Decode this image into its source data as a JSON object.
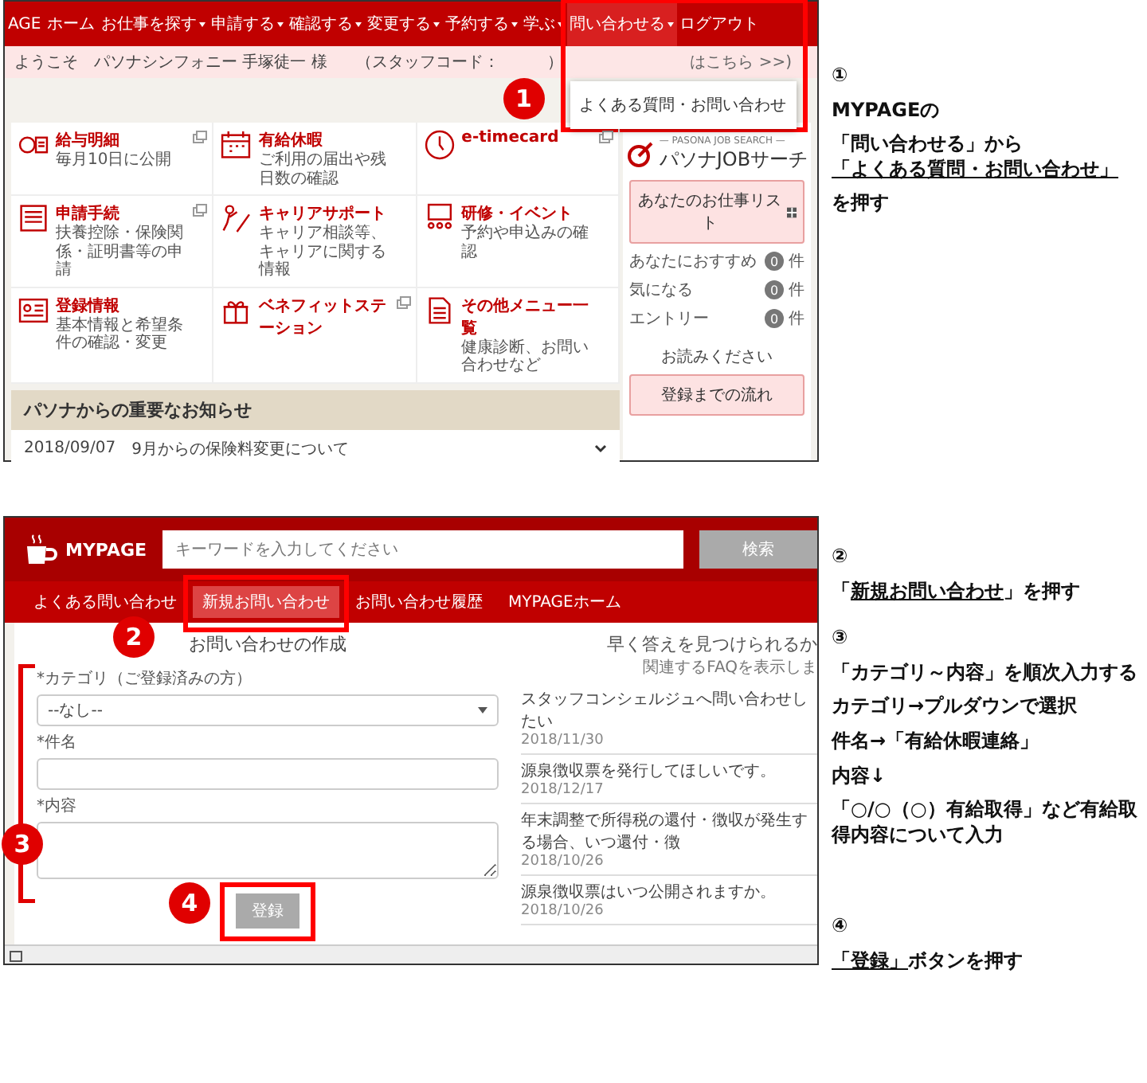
{
  "step1_screen": {
    "nav": [
      {
        "label": "AGE",
        "menu": false,
        "selected": false
      },
      {
        "label": "ホーム",
        "menu": false,
        "selected": false
      },
      {
        "label": "お仕事を探す",
        "menu": true,
        "selected": false
      },
      {
        "label": "申請する",
        "menu": true,
        "selected": false
      },
      {
        "label": "確認する",
        "menu": true,
        "selected": false
      },
      {
        "label": "変更する",
        "menu": true,
        "selected": false
      },
      {
        "label": "予約する",
        "menu": true,
        "selected": false
      },
      {
        "label": "学ぶ",
        "menu": true,
        "selected": false
      },
      {
        "label": "問い合わせる",
        "menu": true,
        "selected": true
      },
      {
        "label": "ログアウト",
        "menu": false,
        "selected": false
      }
    ],
    "dropdown": [
      "よくある質問・お問い合わせ"
    ],
    "callout": "1",
    "welcome": {
      "greeting": "ようこそ　パソナシンフォニー 手塚徒一 様",
      "staff_code": "（スタッフコード：　　　）",
      "link": "はこちら >>)"
    },
    "tiles": [
      {
        "title": "給与明細",
        "description": "毎月10日に公開",
        "external": true
      },
      {
        "title": "有給休暇",
        "description": "ご利用の届出や残日数の確認",
        "external": false
      },
      {
        "title": "e-timecard",
        "external": true
      },
      {
        "title": "申請手続",
        "description": "扶養控除・保険関係・証明書等の申請",
        "external": true
      },
      {
        "title": "キャリアサポート",
        "description": "キャリア相談等、キャリアに関する情報",
        "external": false
      },
      {
        "title": "研修・イベント",
        "description": "予約や申込みの確認",
        "external": false
      },
      {
        "title": "登録情報",
        "description": "基本情報と希望条件の確認・変更",
        "external": false
      },
      {
        "title": "ベネフィットステーション",
        "external": true
      },
      {
        "title": "その他メニュー一覧",
        "description": "健康診断、お問い合わせなど",
        "external": false
      }
    ],
    "sidebar": {
      "logo_caption": "— PASONA JOB SEARCH —",
      "logo_name": "パソナJOBサーチ",
      "list_button": "あなたのお仕事リスト",
      "counts": [
        {
          "label": "あなたにおすすめ",
          "count": "0",
          "unit": "件"
        },
        {
          "label": "気になる",
          "count": "0",
          "unit": "件"
        },
        {
          "label": "エントリー",
          "count": "0",
          "unit": "件"
        }
      ],
      "notice": "お読みください",
      "flow_button": "登録までの流れ"
    },
    "notices": {
      "title": "パソナからの重要なお知らせ",
      "items": [
        {
          "date": "2018/09/07",
          "text": "9月からの保険料変更について"
        }
      ]
    }
  },
  "step2_screen": {
    "logo": "MYPAGE",
    "search_placeholder": "キーワードを入力してください",
    "search_button": "検索",
    "tabs": [
      {
        "label": "よくある問い合わせ",
        "selected": false
      },
      {
        "label": "新規お問い合わせ",
        "selected": true
      },
      {
        "label": "お問い合わせ履歴",
        "selected": false
      },
      {
        "label": "MYPAGEホーム",
        "selected": false
      }
    ],
    "form": {
      "title": "お問い合わせの作成",
      "category_label": "*カテゴリ（ご登録済みの方）",
      "category_value": "--なし--",
      "subject_label": "*件名",
      "content_label": "*内容",
      "submit": "登録"
    },
    "faq": {
      "title": "早く答えを見つけられるか",
      "subtitle": "関連するFAQを表示しま",
      "items": [
        {
          "question": "スタッフコンシェルジュへ問い合わせしたい",
          "date": "2018/11/30"
        },
        {
          "question": "源泉徴収票を発行してほしいです。",
          "date": "2018/12/17"
        },
        {
          "question": "年末調整で所得税の還付・徴収が発生する場合、いつ還付・徴",
          "date": "2018/10/26"
        },
        {
          "question": "源泉徴収票はいつ公開されますか。",
          "date": "2018/10/26"
        }
      ]
    },
    "callouts": [
      "2",
      "3",
      "4"
    ]
  },
  "instructions": [
    {
      "paragraphs": [
        [
          {
            "text": "①"
          }
        ],
        [
          {
            "text": "MYPAGEの"
          }
        ],
        [
          {
            "text": "「問い合わせる」から\n"
          },
          {
            "text": "「よくある質問・お問い合わせ」",
            "underline": true
          }
        ],
        [
          {
            "text": "を押す"
          }
        ]
      ]
    },
    {
      "paragraphs": [
        [
          {
            "text": "②"
          }
        ],
        [
          {
            "text": "「"
          },
          {
            "text": "新規お問い合わせ",
            "underline": true
          },
          {
            "text": "」を押す"
          }
        ]
      ]
    },
    {
      "paragraphs": [
        [
          {
            "text": "③"
          }
        ],
        [
          {
            "text": "「カテゴリ～内容」を順次入力する"
          }
        ],
        [
          {
            "text": "カテゴリ→プルダウンで選択"
          }
        ],
        [
          {
            "text": "件名→「有給休暇連絡」"
          }
        ],
        [
          {
            "text": "内容↓"
          }
        ],
        [
          {
            "text": "「○/○（○）有給取得」など有給取得内容について入力"
          }
        ]
      ]
    },
    {
      "paragraphs": [
        [
          {
            "text": "④"
          }
        ],
        [
          {
            "text": "「登録」",
            "underline": true
          },
          {
            "text": "ボタンを押す"
          }
        ]
      ]
    }
  ]
}
